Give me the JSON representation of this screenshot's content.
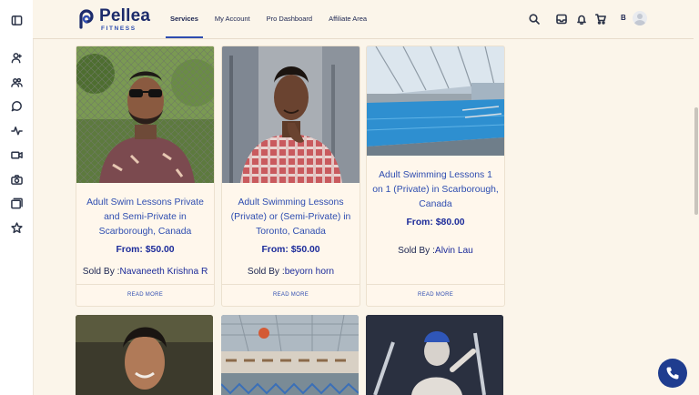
{
  "brand": {
    "name": "Pellea",
    "subtitle": "FITNESS"
  },
  "nav": [
    {
      "label": "Services",
      "active": true
    },
    {
      "label": "My Account",
      "active": false
    },
    {
      "label": "Pro Dashboard",
      "active": false
    },
    {
      "label": "Affiliate Area",
      "active": false
    }
  ],
  "header_icons": [
    "search-icon",
    "inbox-icon",
    "bell-icon",
    "cart-icon"
  ],
  "user": {
    "initial": "B"
  },
  "sidebar_icons": [
    "panel-toggle-icon",
    "user-icon",
    "group-icon",
    "chat-icon",
    "activity-icon",
    "video-icon",
    "camera-icon",
    "gallery-icon",
    "star-icon"
  ],
  "cards": [
    {
      "title": "Adult Swim Lessons Private and Semi-Private in Scarborough, Canada",
      "price": "From: $50.00",
      "seller_prefix": "Sold By :",
      "seller_name": "Navaneeth Krishna R",
      "read_more": "READ MORE"
    },
    {
      "title": "Adult Swimming Lessons (Private) or (Semi-Private) in Toronto, Canada",
      "price": "From: $50.00",
      "seller_prefix": "Sold By :",
      "seller_name": "beyorn horn",
      "read_more": "READ MORE"
    },
    {
      "title": "Adult Swimming Lessons 1 on 1 (Private) in Scarborough, Canada",
      "price": "From: $80.00",
      "seller_prefix": "Sold By :",
      "seller_name": "Alvin Lau",
      "read_more": "READ MORE"
    }
  ],
  "colors": {
    "accent": "#2e4db0",
    "brand_dark": "#1c2b6b",
    "background": "#fbf5ea",
    "phone_button": "#1f3d8f"
  }
}
